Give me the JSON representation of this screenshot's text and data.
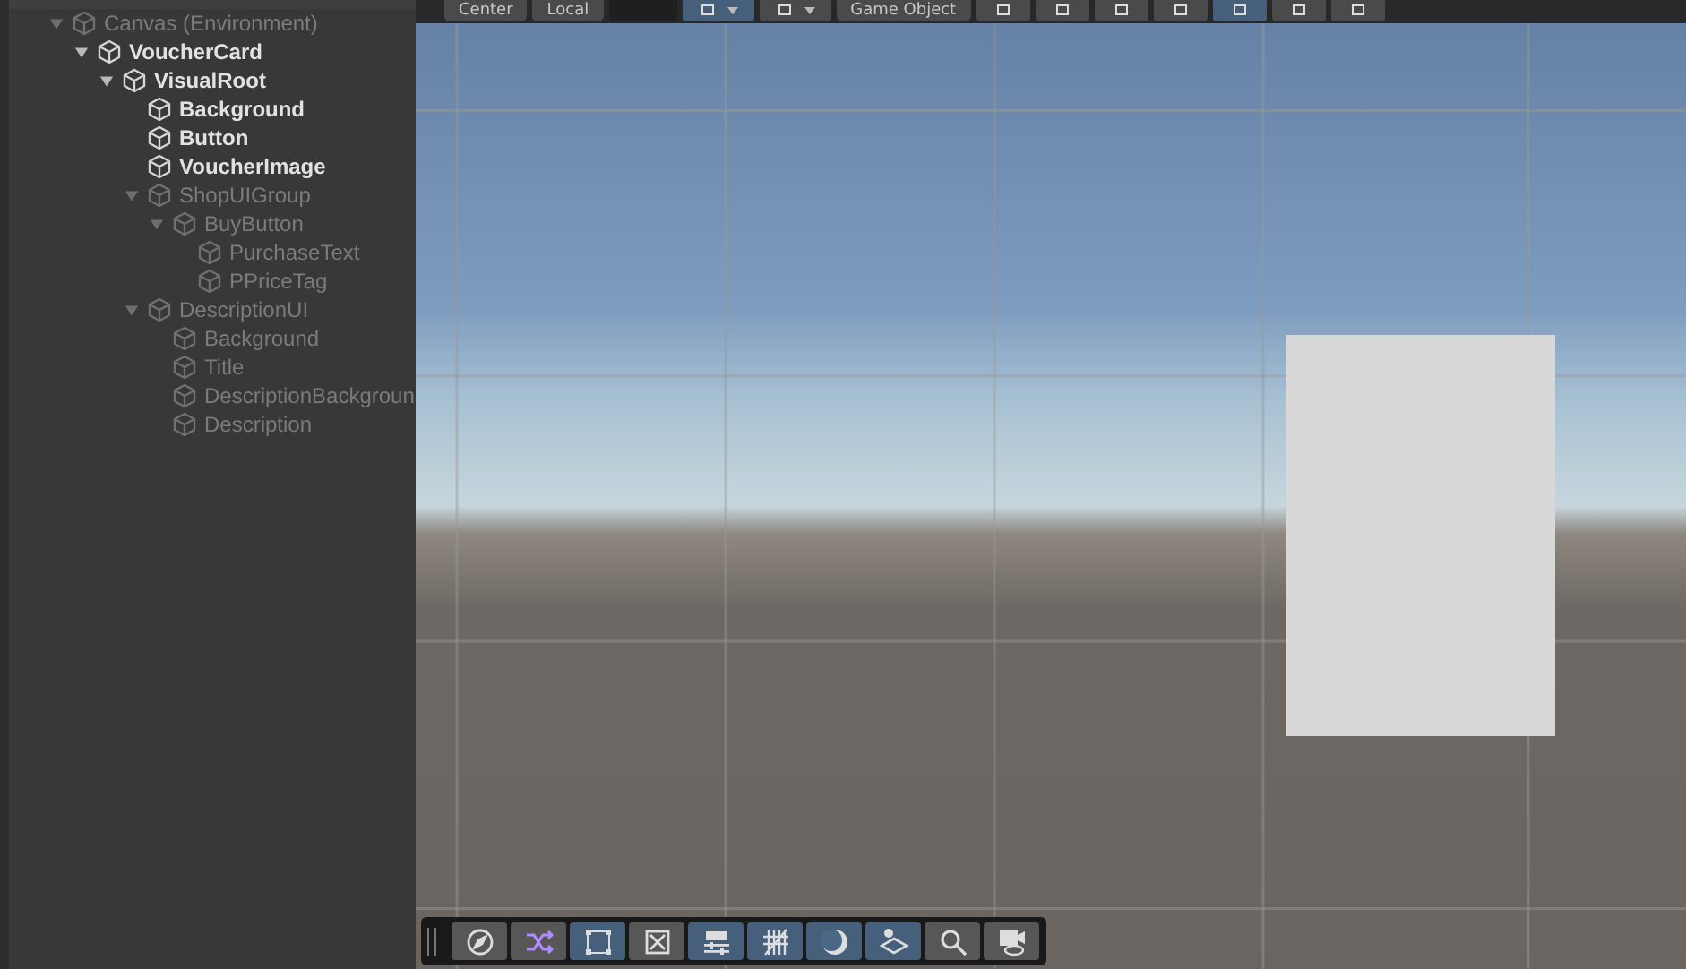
{
  "hierarchy": {
    "items": [
      {
        "label": "Canvas (Environment)",
        "active": false,
        "expanded": true,
        "children": [
          {
            "label": "VoucherCard",
            "active": true,
            "expanded": true,
            "children": [
              {
                "label": "VisualRoot",
                "active": true,
                "expanded": true,
                "children": [
                  {
                    "label": "Background",
                    "active": true
                  },
                  {
                    "label": "Button",
                    "active": true
                  },
                  {
                    "label": "VoucherImage",
                    "active": true
                  },
                  {
                    "label": "ShopUIGroup",
                    "active": false,
                    "expanded": true,
                    "children": [
                      {
                        "label": "BuyButton",
                        "active": false,
                        "expanded": true,
                        "children": [
                          {
                            "label": "PurchaseText",
                            "active": false
                          },
                          {
                            "label": "PPriceTag",
                            "active": false
                          }
                        ]
                      }
                    ]
                  },
                  {
                    "label": "DescriptionUI",
                    "active": false,
                    "expanded": true,
                    "children": [
                      {
                        "label": "Background",
                        "active": false
                      },
                      {
                        "label": "Title",
                        "active": false
                      },
                      {
                        "label": "DescriptionBackgroun",
                        "active": false
                      },
                      {
                        "label": "Description",
                        "active": false
                      }
                    ]
                  }
                ]
              }
            ]
          }
        ]
      }
    ]
  },
  "scene_toolbar": {
    "items": [
      {
        "kind": "dropdown",
        "label": "Center"
      },
      {
        "kind": "dropdown",
        "label": "Local"
      },
      {
        "kind": "field"
      },
      {
        "kind": "tool",
        "selected": true,
        "dropdown": true
      },
      {
        "kind": "tool",
        "selected": false,
        "dropdown": true
      },
      {
        "kind": "dropdown",
        "label": "Game Object"
      },
      {
        "kind": "tool",
        "selected": false
      },
      {
        "kind": "tool",
        "selected": false
      },
      {
        "kind": "tool",
        "selected": false
      },
      {
        "kind": "tool",
        "selected": false
      },
      {
        "kind": "tool",
        "selected": true
      },
      {
        "kind": "tool",
        "selected": false
      },
      {
        "kind": "tool",
        "selected": false
      }
    ]
  },
  "overlay_toolbar": {
    "items": [
      {
        "selected": false
      },
      {
        "selected": false
      },
      {
        "selected": true
      },
      {
        "selected": false
      },
      {
        "selected": true
      },
      {
        "selected": true
      },
      {
        "selected": true
      },
      {
        "selected": true
      },
      {
        "selected": false
      },
      {
        "selected": false
      }
    ]
  }
}
